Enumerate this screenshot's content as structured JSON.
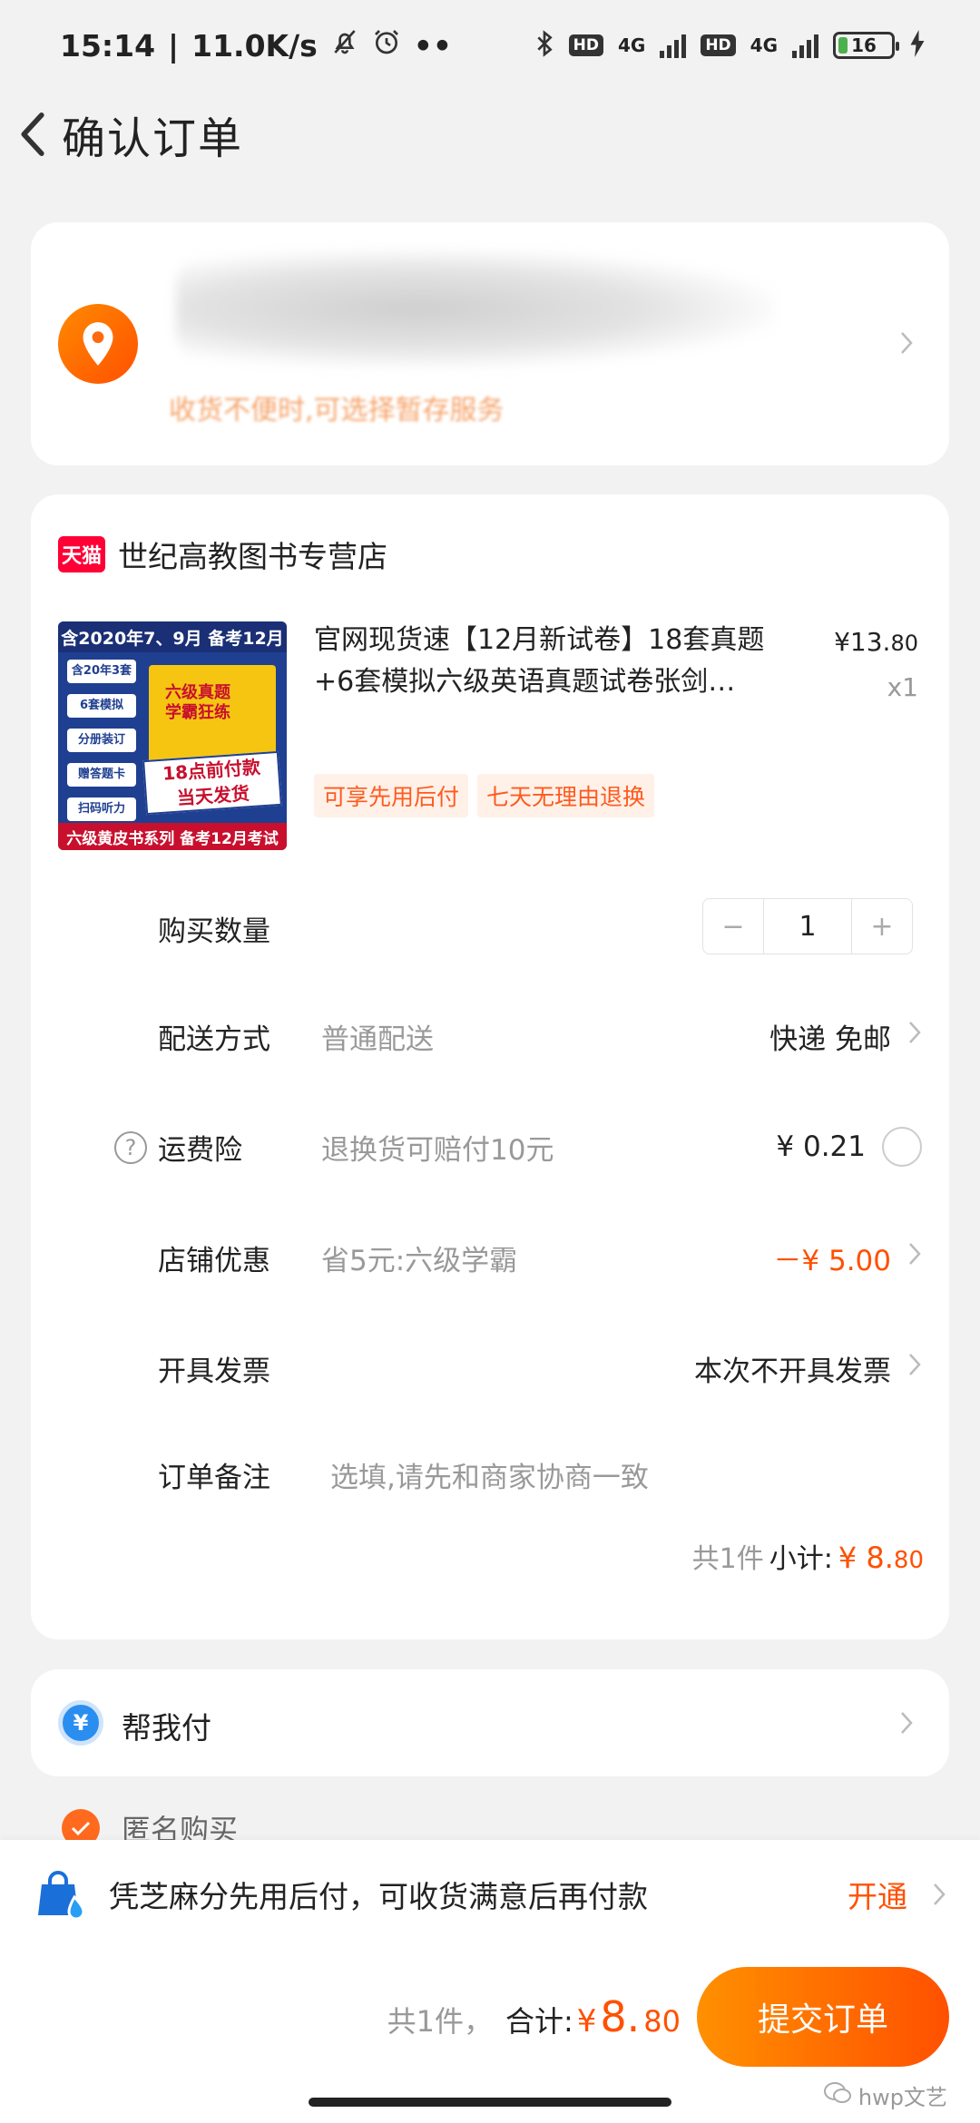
{
  "status_bar": {
    "time": "15:14",
    "net_speed": "11.0K/s",
    "hd1": "HD",
    "sig1": "4G",
    "hd2": "HD",
    "sig2": "4G",
    "battery": "16"
  },
  "header": {
    "title": "确认订单"
  },
  "address": {
    "note": "收货不便时,可选择暂存服务"
  },
  "shop": {
    "badge": "天猫",
    "name": "世纪高教图书专营店"
  },
  "product": {
    "image_top": "含2020年7、9月 备考12月",
    "image_items": [
      "含20年3套",
      "6套模拟",
      "分册装订",
      "赠答题卡",
      "扫码听力"
    ],
    "image_book_title": "六级真题\n学霸狂练",
    "image_stamp": "18点前付款\n当天发货",
    "image_bottom": "六级黄皮书系列 备考12月考试",
    "title": "官网现货速【12月新试卷】18套真题+6套模拟六级英语真题试卷张剑…",
    "price_main": "¥13.",
    "price_cents": "80",
    "qty": "x1",
    "tags": [
      "可享先用后付",
      "七天无理由退换"
    ]
  },
  "rows": {
    "quantity": {
      "label": "购买数量",
      "value": "1",
      "minus": "−",
      "plus": "+"
    },
    "delivery": {
      "label": "配送方式",
      "value": "普通配送",
      "right": "快递 免邮"
    },
    "insurance": {
      "help": "?",
      "label": "运费险",
      "value": "退换货可赔付10元",
      "right": "¥ 0.21"
    },
    "discount": {
      "label": "店铺优惠",
      "value": "省5元:六级学霸",
      "right": "－¥ 5.00"
    },
    "invoice": {
      "label": "开具发票",
      "right": "本次不开具发票"
    },
    "remark": {
      "label": "订单备注",
      "placeholder": "选填,请先和商家协商一致"
    }
  },
  "subtotal": {
    "count": "共1件",
    "label": "小计:",
    "currency": "¥",
    "main": "8.",
    "cents": "80"
  },
  "help_pay": {
    "icon": "¥",
    "label": "帮我付"
  },
  "anonymous": {
    "label": "匿名购买"
  },
  "promo": {
    "text": "凭芝麻分先用后付，可收货满意后再付款",
    "action": "开通"
  },
  "footer": {
    "count": "共1件，",
    "label": "合计:",
    "currency": "¥",
    "main": "8.",
    "cents": "80",
    "submit": "提交订单",
    "watermark": "hwp文艺"
  },
  "colors": {
    "accent": "#ff5000",
    "accent_light": "#ff9000",
    "tmall_red": "#ff0036"
  }
}
